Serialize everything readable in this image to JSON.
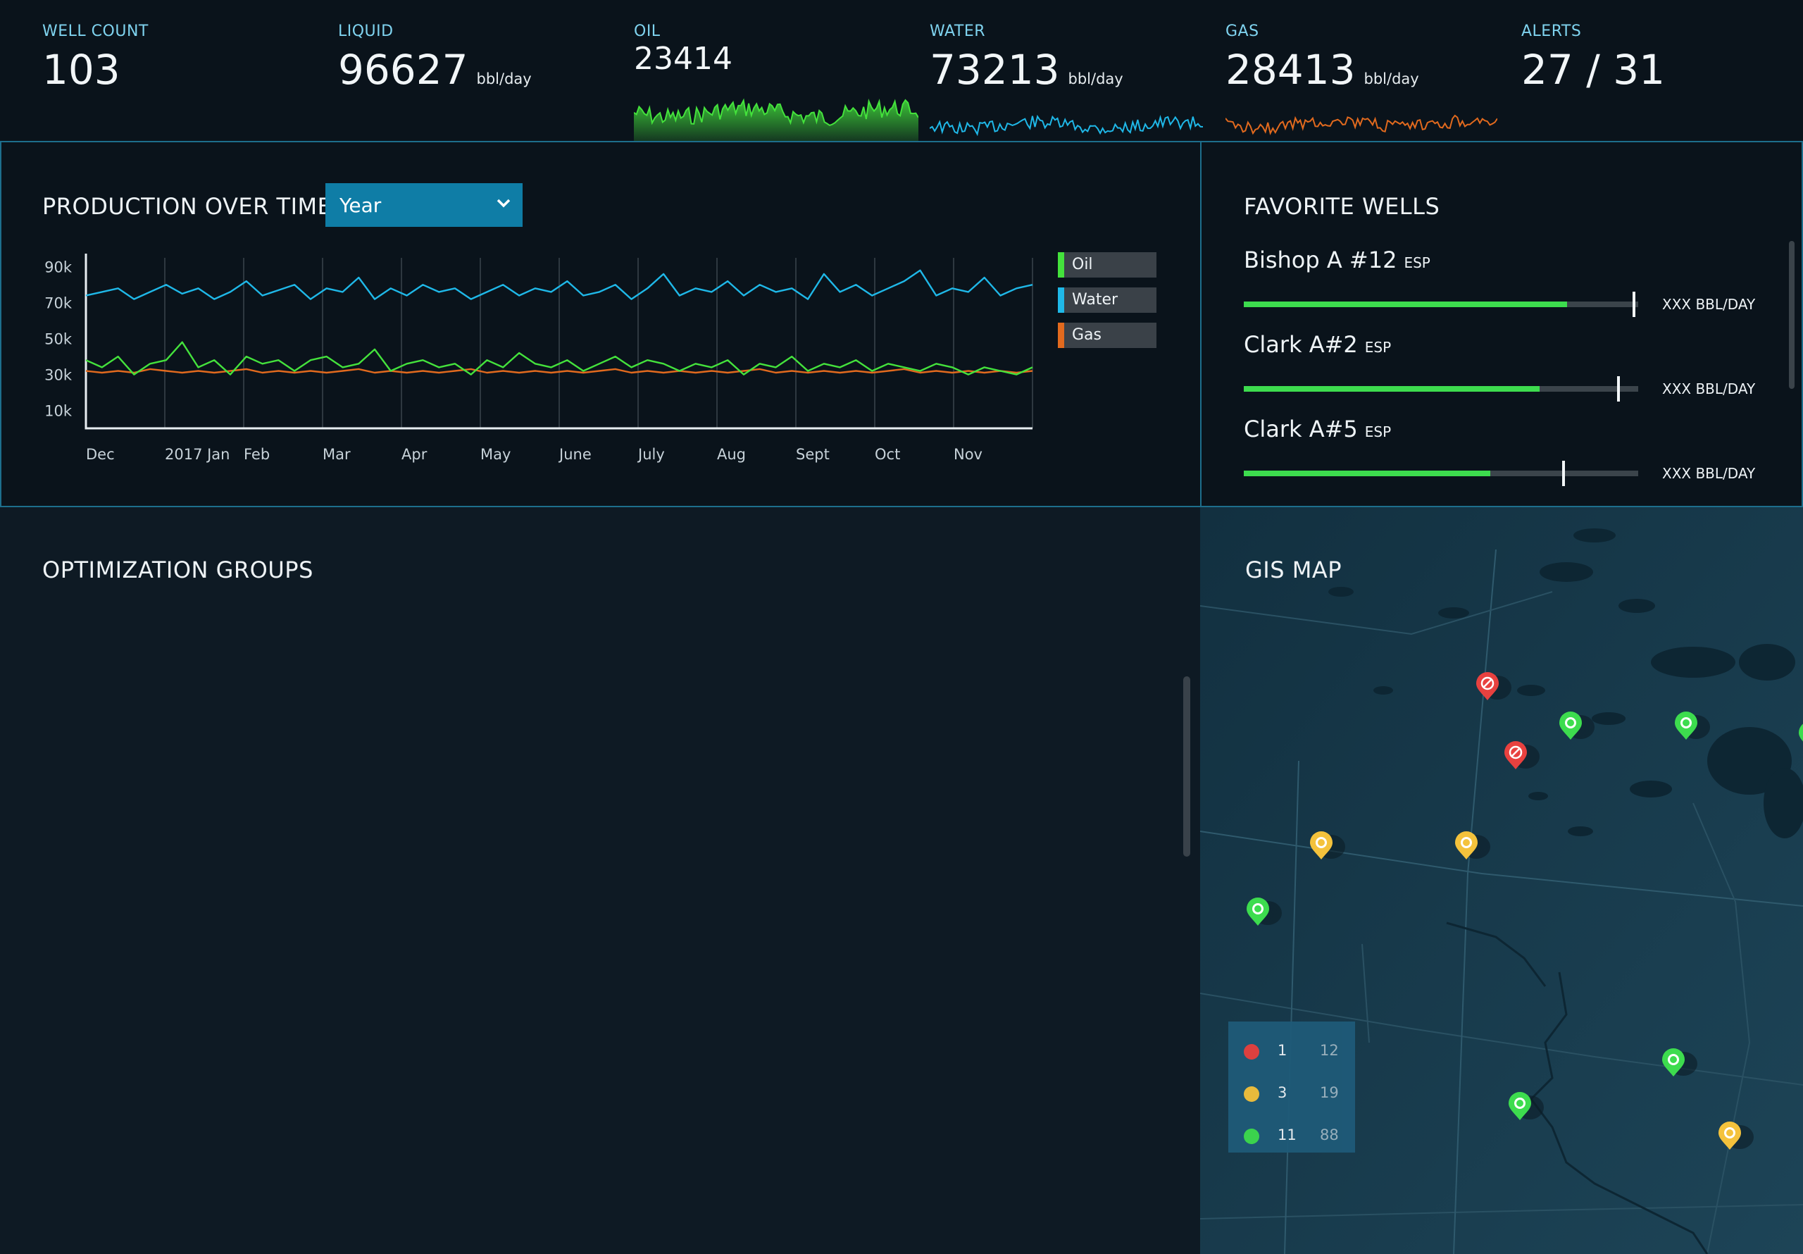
{
  "kpis": {
    "well_count": {
      "label": "WELL COUNT",
      "value": "103"
    },
    "liquid": {
      "label": "LIQUID",
      "value": "96627",
      "unit": "bbl/day"
    },
    "oil": {
      "label": "OIL",
      "value": "23414"
    },
    "water": {
      "label": "WATER",
      "value": "73213",
      "unit": "bbl/day"
    },
    "gas": {
      "label": "GAS",
      "value": "28413",
      "unit": "bbl/day"
    },
    "alerts": {
      "label": "ALERTS",
      "value": "27 / 31"
    }
  },
  "colors": {
    "oil": "#44e23c",
    "water": "#1fb8e8",
    "gas": "#e26a1e",
    "accent": "#0f7da6",
    "panel_border": "#1d6e8c",
    "alert_red": "#e8413f",
    "warn_yellow": "#f4c23c",
    "ok_green": "#3ddc4e"
  },
  "production": {
    "title": "PRODUCTION OVER TIME",
    "range_select": {
      "value": "Year",
      "icon": "chevron-down-icon"
    },
    "legend": [
      {
        "name": "Oil",
        "color": "#44e23c"
      },
      {
        "name": "Water",
        "color": "#1fb8e8"
      },
      {
        "name": "Gas",
        "color": "#e26a1e"
      }
    ]
  },
  "chart_data": {
    "type": "line",
    "title": "PRODUCTION OVER TIME",
    "xlabel": "",
    "ylabel": "",
    "x_ticks": [
      "Dec",
      "2017 Jan",
      "Feb",
      "Mar",
      "Apr",
      "May",
      "June",
      "July",
      "Aug",
      "Sept",
      "Oct",
      "Nov"
    ],
    "y_ticks": [
      "90k",
      "70k",
      "50k",
      "30k",
      "10k"
    ],
    "ylim": [
      0,
      95000
    ],
    "grid": "vertical",
    "legend_position": "right",
    "series": [
      {
        "name": "Water",
        "color": "#1fb8e8",
        "values": [
          74000,
          76000,
          78000,
          72000,
          76000,
          80000,
          75000,
          78000,
          72000,
          76000,
          82000,
          74000,
          77000,
          80000,
          72000,
          78000,
          76000,
          84000,
          72000,
          78000,
          74000,
          80000,
          76000,
          78000,
          72000,
          76000,
          80000,
          74000,
          78000,
          76000,
          82000,
          74000,
          76000,
          80000,
          72000,
          78000,
          86000,
          74000,
          78000,
          76000,
          82000,
          74000,
          80000,
          76000,
          78000,
          72000,
          86000,
          76000,
          80000,
          74000,
          78000,
          82000,
          88000,
          74000,
          78000,
          76000,
          84000,
          74000,
          78000,
          80000
        ]
      },
      {
        "name": "Oil",
        "color": "#44e23c",
        "values": [
          38000,
          34000,
          40000,
          30000,
          36000,
          38000,
          48000,
          34000,
          38000,
          30000,
          40000,
          36000,
          38000,
          32000,
          38000,
          40000,
          34000,
          36000,
          44000,
          32000,
          36000,
          38000,
          34000,
          36000,
          30000,
          38000,
          34000,
          42000,
          36000,
          34000,
          38000,
          32000,
          36000,
          40000,
          34000,
          38000,
          36000,
          32000,
          36000,
          34000,
          38000,
          30000,
          36000,
          34000,
          40000,
          32000,
          36000,
          34000,
          38000,
          32000,
          36000,
          34000,
          32000,
          36000,
          34000,
          30000,
          34000,
          32000,
          30000,
          34000
        ]
      },
      {
        "name": "Gas",
        "color": "#e26a1e",
        "values": [
          32000,
          31000,
          32000,
          31000,
          33000,
          32000,
          31000,
          32000,
          31000,
          32000,
          33000,
          31000,
          32000,
          31000,
          32000,
          31000,
          32000,
          33000,
          31000,
          32000,
          31000,
          32000,
          31000,
          32000,
          33000,
          31000,
          32000,
          31000,
          32000,
          31000,
          32000,
          31000,
          32000,
          33000,
          31000,
          32000,
          31000,
          32000,
          31000,
          32000,
          31000,
          32000,
          33000,
          31000,
          32000,
          31000,
          32000,
          31000,
          32000,
          31000,
          32000,
          33000,
          31000,
          32000,
          31000,
          32000,
          31000,
          32000,
          31000,
          32000
        ]
      }
    ]
  },
  "favorites": {
    "title": "FAVORITE WELLS",
    "wells": [
      {
        "name": "Bishop A #12",
        "tag": "ESP",
        "rate": "XXX BBL/DAY",
        "fill": 0.82,
        "target": 0.99
      },
      {
        "name": "Clark A#2",
        "tag": "ESP",
        "rate": "XXX BBL/DAY",
        "fill": 0.75,
        "target": 0.95
      },
      {
        "name": "Clark A#5",
        "tag": "ESP",
        "rate": "XXX BBL/DAY",
        "fill": 0.625,
        "target": 0.81
      }
    ]
  },
  "optimization": {
    "title": "OPTIMIZATION GROUPS"
  },
  "gis": {
    "title": "GIS MAP",
    "legend": [
      {
        "color": "#e8413f",
        "count": "1",
        "total": "12"
      },
      {
        "color": "#f4c23c",
        "count": "3",
        "total": "19"
      },
      {
        "color": "#3ddc4e",
        "count": "11",
        "total": "88"
      }
    ],
    "pins": [
      {
        "status": "alert",
        "icon": "alert-pin-icon"
      },
      {
        "status": "alert",
        "icon": "alert-pin-icon"
      },
      {
        "status": "ok",
        "icon": "ok-pin-icon"
      },
      {
        "status": "ok",
        "icon": "ok-pin-icon"
      },
      {
        "status": "ok",
        "icon": "ok-pin-icon"
      },
      {
        "status": "warning",
        "icon": "warning-pin-icon"
      },
      {
        "status": "warning",
        "icon": "warning-pin-icon"
      },
      {
        "status": "ok",
        "icon": "ok-pin-icon"
      },
      {
        "status": "ok",
        "icon": "ok-pin-icon"
      },
      {
        "status": "ok",
        "icon": "ok-pin-icon"
      },
      {
        "status": "warning",
        "icon": "warning-pin-icon"
      }
    ]
  }
}
